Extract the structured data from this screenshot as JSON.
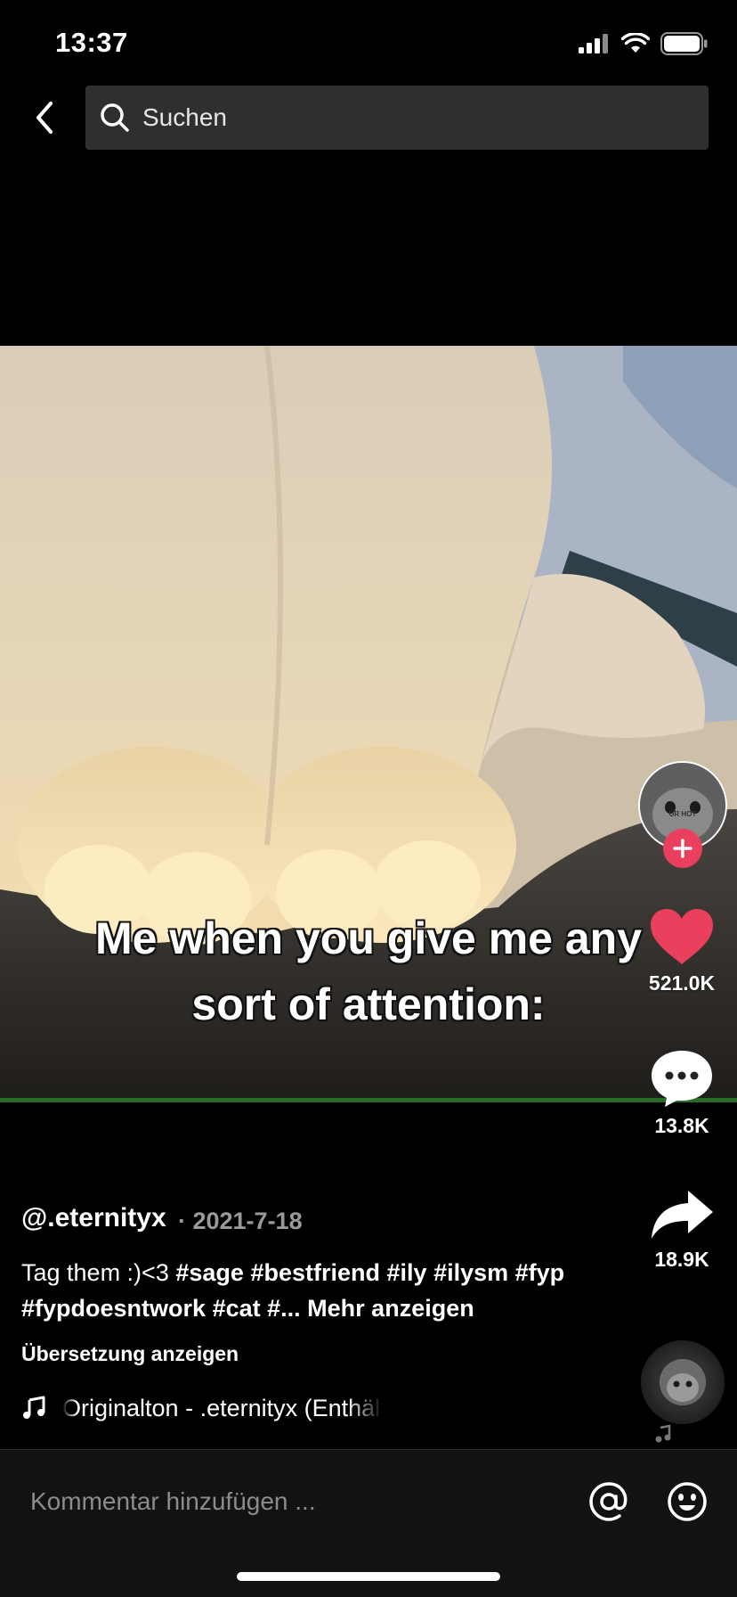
{
  "status_bar": {
    "time": "13:37"
  },
  "search": {
    "placeholder": "Suchen"
  },
  "video": {
    "caption_line1": "Me when you give me any",
    "caption_line2": "sort of attention:",
    "avatar_text": "UR HOT"
  },
  "actions": {
    "likes": "521.0K",
    "comments": "13.8K",
    "shares": "18.9K"
  },
  "post": {
    "username": "@.eternityx",
    "date": "· 2021-7-18",
    "text": "Tag them :)<3",
    "hashtags": [
      "#sage",
      "#bestfriend",
      "#ily",
      "#ilysm",
      "#fyp",
      "#fypdoesntwork",
      "#cat",
      "#..."
    ],
    "more_label": "Mehr anzeigen",
    "translate_label": "Übersetzung anzeigen",
    "sound": "Originalton - .eternityx (Enthält"
  },
  "comment_bar": {
    "placeholder": "Kommentar hinzufügen ..."
  },
  "colors": {
    "accent": "#ea3f5d",
    "background": "#000000",
    "progress": "#2a6b2a"
  }
}
